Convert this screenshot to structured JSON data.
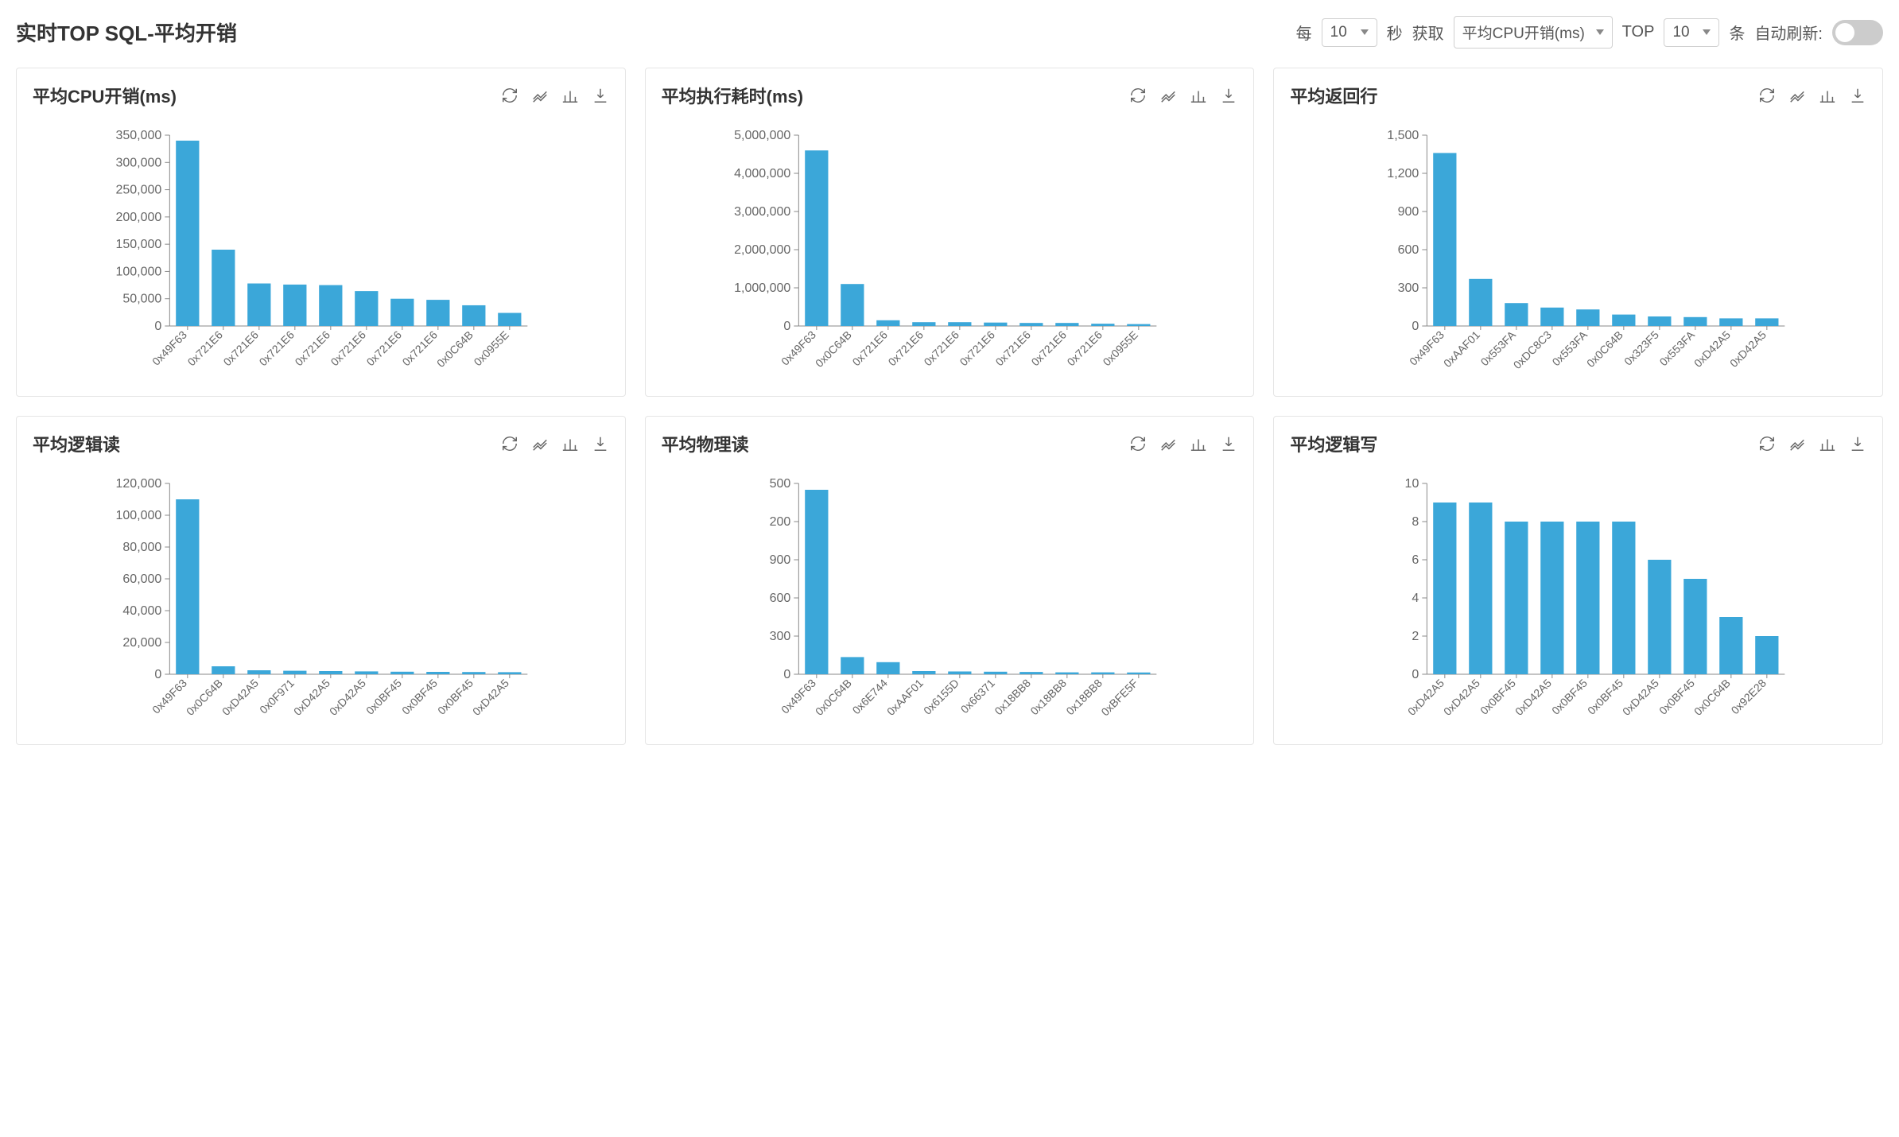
{
  "page_title": "实时TOP SQL-平均开销",
  "controls": {
    "every_label": "每",
    "interval_value": "10",
    "seconds_label": "秒",
    "fetch_label": "获取",
    "metric_value": "平均CPU开销(ms)",
    "top_label": "TOP",
    "top_value": "10",
    "items_label": "条",
    "auto_refresh_label": "自动刷新:"
  },
  "chart_data": [
    {
      "id": "cpu",
      "title": "平均CPU开销(ms)",
      "type": "bar",
      "categories": [
        "0x49F63",
        "0x721E6",
        "0x721E6",
        "0x721E6",
        "0x721E6",
        "0x721E6",
        "0x721E6",
        "0x721E6",
        "0x0C64B",
        "0x0955E"
      ],
      "values": [
        340000,
        140000,
        78000,
        76000,
        75000,
        64000,
        50000,
        48000,
        38000,
        24000
      ],
      "ylim": [
        0,
        350000
      ],
      "ytick": 50000
    },
    {
      "id": "exec",
      "title": "平均执行耗时(ms)",
      "type": "bar",
      "categories": [
        "0x49F63",
        "0x0C64B",
        "0x721E6",
        "0x721E6",
        "0x721E6",
        "0x721E6",
        "0x721E6",
        "0x721E6",
        "0x721E6",
        "0x0955E"
      ],
      "values": [
        4600000,
        1100000,
        150000,
        100000,
        100000,
        90000,
        80000,
        80000,
        60000,
        50000
      ],
      "ylim": [
        0,
        5000000
      ],
      "ytick": 1000000
    },
    {
      "id": "rows",
      "title": "平均返回行",
      "type": "bar",
      "categories": [
        "0x49F63",
        "0xAAF01",
        "0x553FA",
        "0xDC8C3",
        "0x553FA",
        "0x0C64B",
        "0x323F5",
        "0x553FA",
        "0xD42A5",
        "0xD42A5"
      ],
      "values": [
        1360,
        370,
        180,
        145,
        130,
        90,
        75,
        70,
        60,
        60
      ],
      "ylim": [
        0,
        1500
      ],
      "ytick": 300
    },
    {
      "id": "lread",
      "title": "平均逻辑读",
      "type": "bar",
      "categories": [
        "0x49F63",
        "0x0C64B",
        "0xD42A5",
        "0x0F971",
        "0xD42A5",
        "0xD42A5",
        "0x0BF45",
        "0x0BF45",
        "0x0BF45",
        "0xD42A5"
      ],
      "values": [
        110000,
        5000,
        2500,
        2200,
        2000,
        1800,
        1600,
        1500,
        1400,
        1300
      ],
      "ylim": [
        0,
        120000
      ],
      "ytick": 20000
    },
    {
      "id": "pread",
      "title": "平均物理读",
      "type": "bar",
      "categories": [
        "0x49F63",
        "0x0C64B",
        "0x6E744",
        "0xAAF01",
        "0x6155D",
        "0x66371",
        "0x18BB8",
        "0x18BB8",
        "0x18BB8",
        "0xBFE5F"
      ],
      "values": [
        1450,
        135,
        95,
        25,
        22,
        20,
        18,
        15,
        15,
        14
      ],
      "ylim": [
        0,
        1500
      ],
      "ytick": 300,
      "yticks_label": [
        0,
        300,
        600,
        900,
        200,
        500
      ]
    },
    {
      "id": "lwrite",
      "title": "平均逻辑写",
      "type": "bar",
      "categories": [
        "0xD42A5",
        "0xD42A5",
        "0x0BF45",
        "0xD42A5",
        "0x0BF45",
        "0x0BF45",
        "0xD42A5",
        "0x0BF45",
        "0x0C64B",
        "0x92E28"
      ],
      "values": [
        9,
        9,
        8,
        8,
        8,
        8,
        6,
        5,
        3,
        2
      ],
      "ylim": [
        0,
        10
      ],
      "ytick": 2
    }
  ],
  "icons": {
    "refresh": "刷新",
    "line": "折线",
    "bar": "柱状",
    "download": "下载"
  },
  "colors": {
    "bar": "#3ba7d9"
  }
}
